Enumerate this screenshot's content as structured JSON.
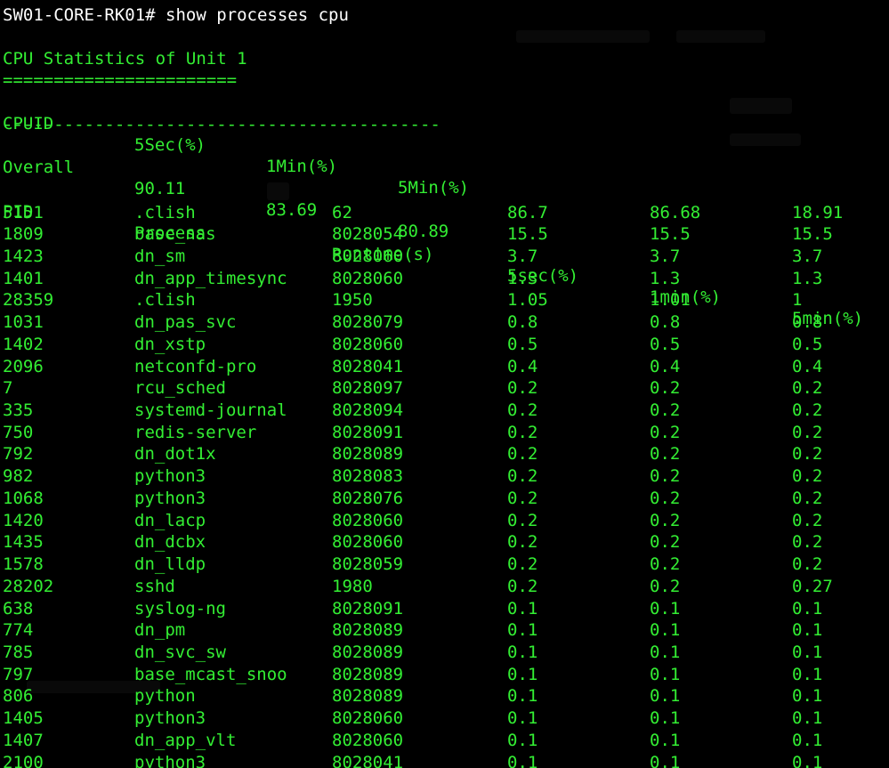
{
  "window": {
    "prompt": "SW01-CORE-RK01# show processes cpu",
    "colors": {
      "background": "#000000",
      "text_green": "#33ee33",
      "prompt_white": "#ffffff"
    }
  },
  "cpu_stats": {
    "title": "CPU Statistics of Unit 1",
    "title_underline": "=======================",
    "headers": [
      "CPUID",
      "5Sec(%)",
      "1Min(%)",
      "5Min(%)"
    ],
    "separator": "-------------------------------------------",
    "overall": [
      "Overall",
      "90.11",
      "83.69",
      "80.89"
    ]
  },
  "process_table": {
    "headers": [
      "PID",
      "Process",
      "Runtime(s)",
      "5sec(%)",
      "1min(%)",
      "5min(%)"
    ],
    "rows": [
      [
        "5151",
        ".clish",
        "62",
        "86.7",
        "86.68",
        "18.91"
      ],
      [
        "1809",
        "base_nas",
        "8028054",
        "15.5",
        "15.5",
        "15.5"
      ],
      [
        "1423",
        "dn_sm",
        "8028060",
        "3.7",
        "3.7",
        "3.7"
      ],
      [
        "1401",
        "dn_app_timesync",
        "8028060",
        "1.3",
        "1.3",
        "1.3"
      ],
      [
        "28359",
        ".clish",
        "1950",
        "1.05",
        "1.01",
        "1"
      ],
      [
        "1031",
        "dn_pas_svc",
        "8028079",
        "0.8",
        "0.8",
        "0.8"
      ],
      [
        "1402",
        "dn_xstp",
        "8028060",
        "0.5",
        "0.5",
        "0.5"
      ],
      [
        "2096",
        "netconfd-pro",
        "8028041",
        "0.4",
        "0.4",
        "0.4"
      ],
      [
        "7",
        "rcu_sched",
        "8028097",
        "0.2",
        "0.2",
        "0.2"
      ],
      [
        "335",
        "systemd-journal",
        "8028094",
        "0.2",
        "0.2",
        "0.2"
      ],
      [
        "750",
        "redis-server",
        "8028091",
        "0.2",
        "0.2",
        "0.2"
      ],
      [
        "792",
        "dn_dot1x",
        "8028089",
        "0.2",
        "0.2",
        "0.2"
      ],
      [
        "982",
        "python3",
        "8028083",
        "0.2",
        "0.2",
        "0.2"
      ],
      [
        "1068",
        "python3",
        "8028076",
        "0.2",
        "0.2",
        "0.2"
      ],
      [
        "1420",
        "dn_lacp",
        "8028060",
        "0.2",
        "0.2",
        "0.2"
      ],
      [
        "1435",
        "dn_dcbx",
        "8028060",
        "0.2",
        "0.2",
        "0.2"
      ],
      [
        "1578",
        "dn_lldp",
        "8028059",
        "0.2",
        "0.2",
        "0.2"
      ],
      [
        "28202",
        "sshd",
        "1980",
        "0.2",
        "0.2",
        "0.27"
      ],
      [
        "638",
        "syslog-ng",
        "8028091",
        "0.1",
        "0.1",
        "0.1"
      ],
      [
        "774",
        "dn_pm",
        "8028089",
        "0.1",
        "0.1",
        "0.1"
      ],
      [
        "785",
        "dn_svc_sw",
        "8028089",
        "0.1",
        "0.1",
        "0.1"
      ],
      [
        "797",
        "base_mcast_snoo",
        "8028089",
        "0.1",
        "0.1",
        "0.1"
      ],
      [
        "806",
        "python",
        "8028089",
        "0.1",
        "0.1",
        "0.1"
      ],
      [
        "1405",
        "python3",
        "8028060",
        "0.1",
        "0.1",
        "0.1"
      ],
      [
        "1407",
        "dn_app_vlt",
        "8028060",
        "0.1",
        "0.1",
        "0.1"
      ],
      [
        "2100",
        "python3",
        "8028041",
        "0.1",
        "0.1",
        "0.1"
      ]
    ]
  }
}
